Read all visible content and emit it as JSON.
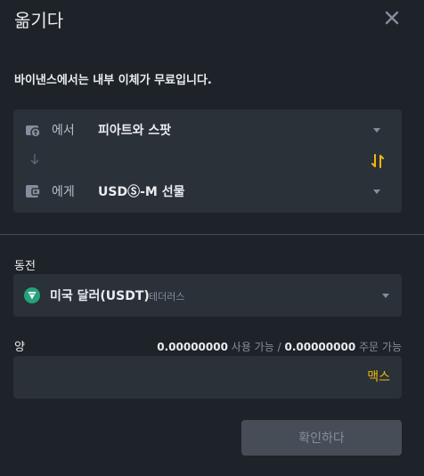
{
  "header": {
    "title": "옮기다"
  },
  "notice": "바이낸스에서는 내부 이체가 무료입니다.",
  "transfer": {
    "from_label": "에서",
    "from_value": "피아트와 스팟",
    "to_label": "에게",
    "to_value": "USDⓈ-M 선물"
  },
  "coin": {
    "label": "동전",
    "name": "미국 달러(USDT)",
    "sub": "테더러스"
  },
  "amount": {
    "label": "양",
    "available": "0.00000000",
    "available_text": "사용 가능",
    "separator": "/",
    "order_available": "0.00000000",
    "order_text": "주문 가능",
    "placeholder": "",
    "max_label": "맥스"
  },
  "confirm_label": "확인하다",
  "colors": {
    "accent": "#f0b90b",
    "bg": "#1e2329",
    "panel": "#2b3139",
    "usdt": "#26a17b"
  },
  "icons": [
    "close-icon",
    "wallet-icon",
    "arrow-down-icon",
    "swap-icon",
    "usdt-icon",
    "chevron-down-icon"
  ]
}
